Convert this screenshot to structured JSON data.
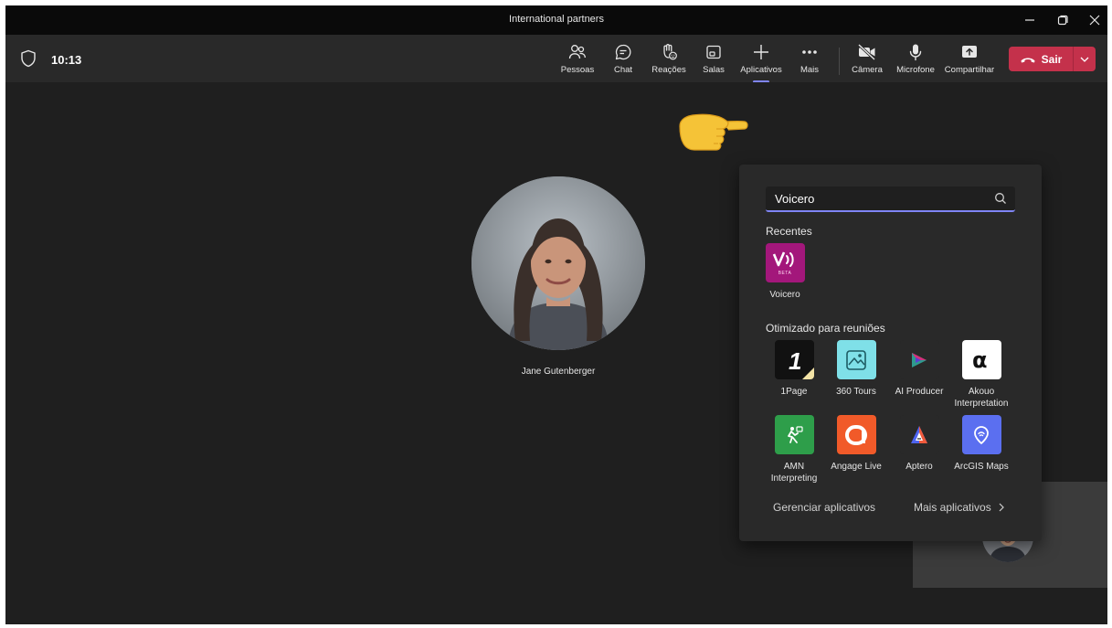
{
  "window": {
    "title": "International partners",
    "controls": [
      "minimize-icon",
      "restore-icon",
      "close-icon"
    ]
  },
  "toolbar": {
    "timer": "10:13",
    "buttons": [
      {
        "label": "Pessoas",
        "icon": "people-icon"
      },
      {
        "label": "Chat",
        "icon": "chat-icon"
      },
      {
        "label": "Reações",
        "icon": "raise-hand-icon"
      },
      {
        "label": "Salas",
        "icon": "breakout-rooms-icon"
      },
      {
        "label": "Aplicativos",
        "icon": "plus-icon"
      },
      {
        "label": "Mais",
        "icon": "more-icon"
      },
      {
        "label": "Câmera",
        "icon": "camera-off-icon"
      },
      {
        "label": "Microfone",
        "icon": "microphone-icon"
      },
      {
        "label": "Compartilhar",
        "icon": "share-screen-icon"
      }
    ],
    "leave_label": "Sair"
  },
  "stage": {
    "participant_name": "Jane Gutenberger"
  },
  "apps_flyout": {
    "search_value": "Voicero",
    "recent_title": "Recentes",
    "recent_apps": [
      {
        "name": "Voicero",
        "badge": "BETA",
        "color": "#a3177b"
      }
    ],
    "optimized_title": "Otimizado para reuniões",
    "optimized_apps": [
      {
        "name": "1Page",
        "color": "#111111"
      },
      {
        "name": "360 Tours",
        "color": "#7fe0e8"
      },
      {
        "name": "AI Producer",
        "color": "#292929"
      },
      {
        "name": "Akouo Interpretation",
        "color": "#ffffff"
      },
      {
        "name": "AMN Interpreting",
        "color": "#2e9e4a"
      },
      {
        "name": "Angage Live",
        "color": "#f15a29"
      },
      {
        "name": "Aptero",
        "color": "#292929"
      },
      {
        "name": "ArcGIS Maps",
        "color": "#5b6ff0"
      }
    ],
    "manage_label": "Gerenciar aplicativos",
    "more_label": "Mais aplicativos"
  },
  "colors": {
    "accent": "#7f85f5",
    "leave": "#c4314b",
    "background": "#1f1f1f",
    "toolbar": "#292929"
  }
}
